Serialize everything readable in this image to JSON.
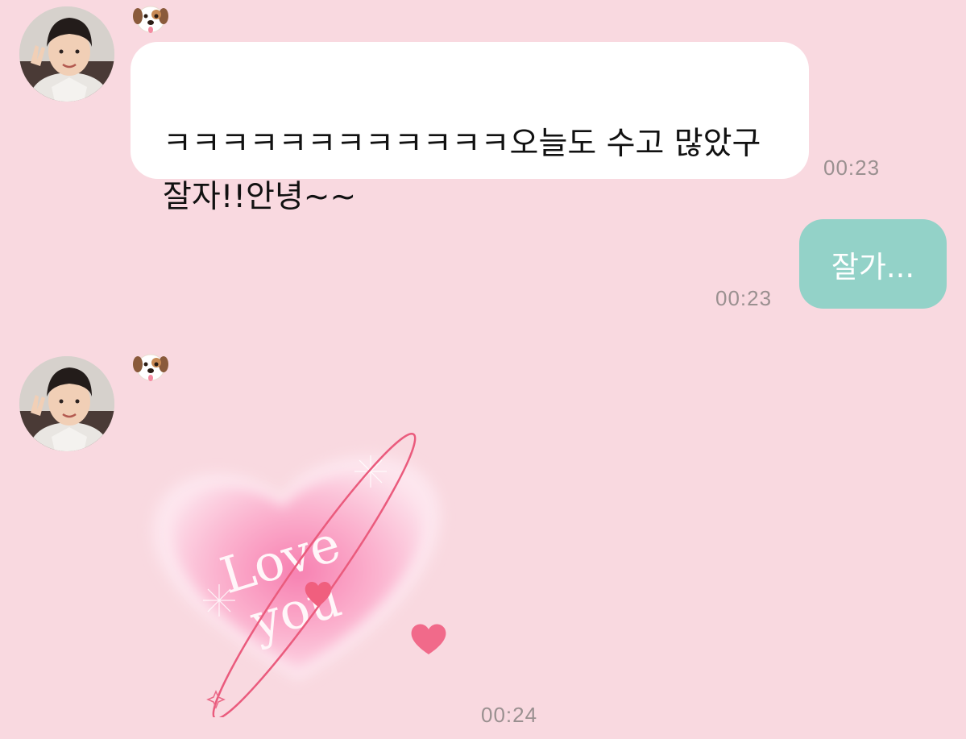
{
  "messages": [
    {
      "direction": "incoming",
      "sender_icon": "dog-face-icon",
      "text": "ㅋㅋㅋㅋㅋㅋㅋㅋㅋㅋㅋㅋ오늘도 수고 많았구\n잘자!!안녕~~",
      "time": "00:23"
    },
    {
      "direction": "outgoing",
      "text": "잘가...",
      "time": "00:23"
    },
    {
      "direction": "incoming",
      "sender_icon": "dog-face-icon",
      "sticker": {
        "line1": "Love",
        "line2": "you",
        "icon": "heart-sticker-icon"
      },
      "time": "00:24"
    }
  ],
  "colors": {
    "background": "#f9d9e0",
    "incoming_bubble": "#ffffff",
    "outgoing_bubble": "#93d2c8",
    "timestamp": "#9a9090"
  }
}
